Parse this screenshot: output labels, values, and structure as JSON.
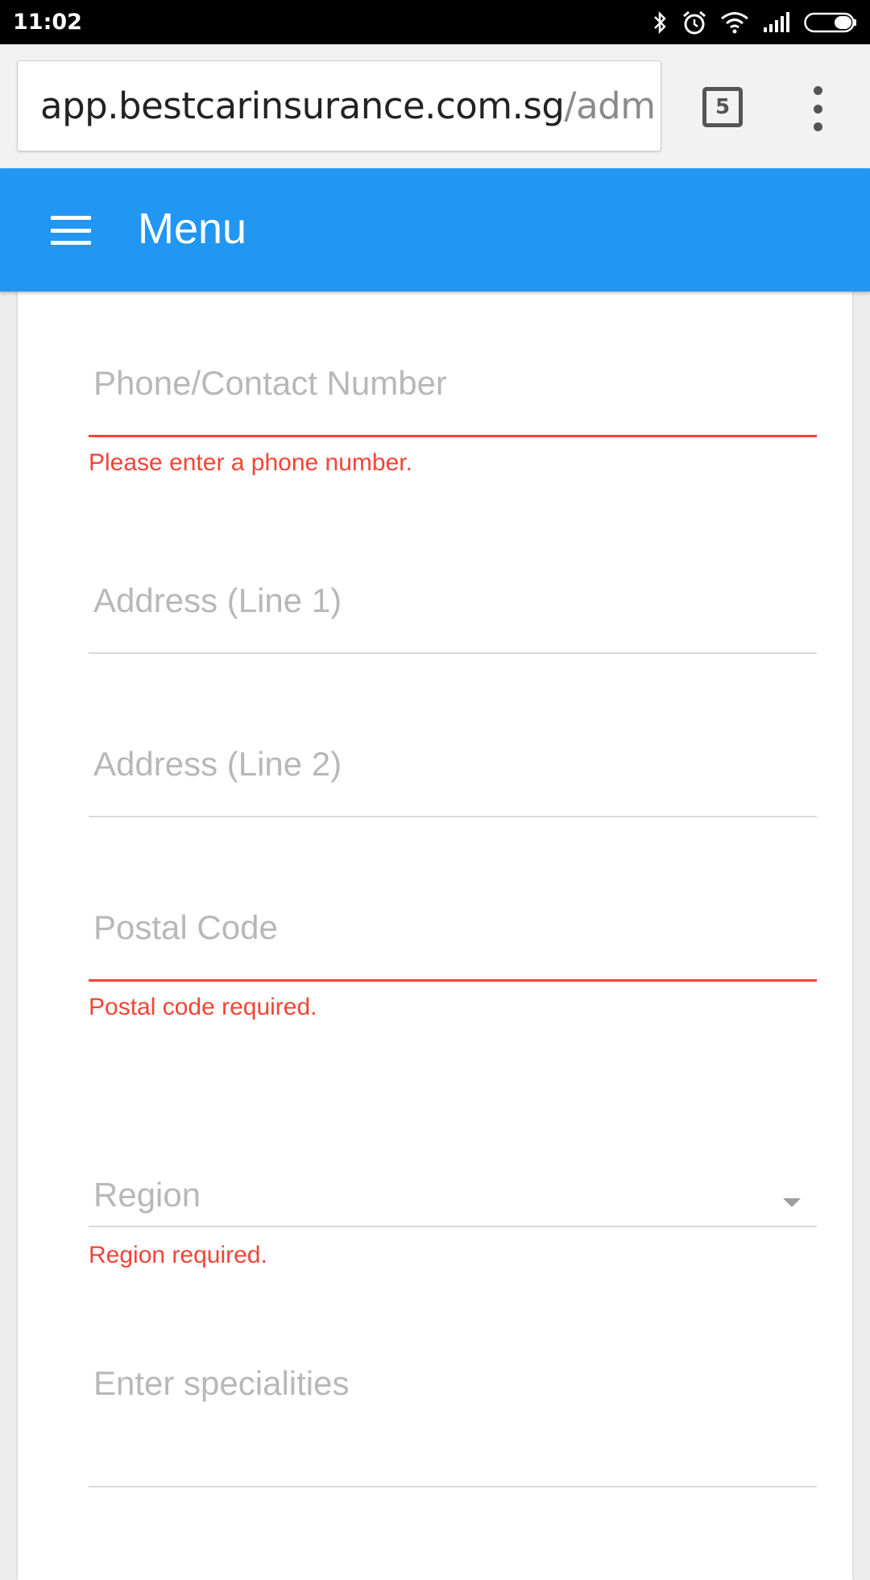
{
  "status_bar": {
    "time": "11:02",
    "icons": [
      "bluetooth-icon",
      "alarm-icon",
      "wifi-icon",
      "signal-icon",
      "battery-icon"
    ]
  },
  "browser": {
    "url_domain": "app.bestcarinsurance.com.sg",
    "url_path": "/adm",
    "tab_count": "5"
  },
  "header": {
    "title": "Menu",
    "background_color": "#2196f3"
  },
  "form": {
    "phone": {
      "placeholder": "Phone/Contact Number",
      "error": "Please enter a phone number."
    },
    "address1": {
      "placeholder": "Address (Line 1)"
    },
    "address2": {
      "placeholder": "Address (Line 2)"
    },
    "postal": {
      "placeholder": "Postal Code",
      "error": "Postal code required."
    },
    "region": {
      "placeholder": "Region",
      "error": "Region required."
    },
    "specialities": {
      "placeholder": "Enter specialities"
    }
  },
  "colors": {
    "error": "#f44336",
    "placeholder": "#b8b8b8"
  }
}
